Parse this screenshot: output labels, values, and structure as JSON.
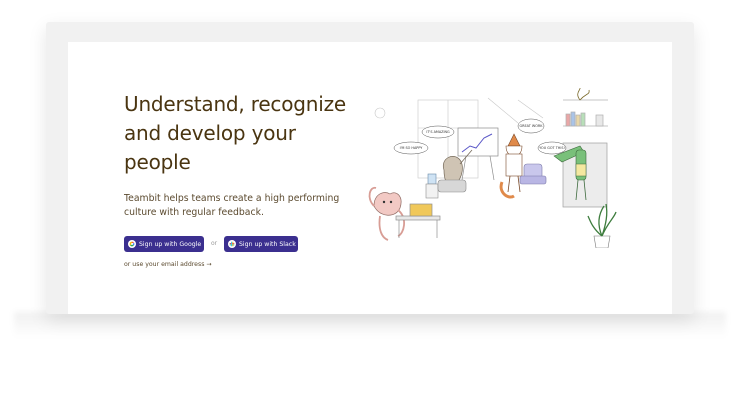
{
  "hero": {
    "headline": "Understand, recognize and develop your people",
    "subtext": "Teambit helps teams create a high performing culture with regular feedback."
  },
  "cta": {
    "google_label": "Sign up with Google",
    "or_label": "or",
    "slack_label": "Sign up with Slack",
    "email_link": "or use your email address →"
  },
  "illustration": {
    "bubbles": [
      "I'M SO HAPPY",
      "IT'S AMAZING",
      "GREAT WORK",
      "YOU GOT THIS!"
    ]
  },
  "colors": {
    "headline": "#4a3511",
    "button": "#3b2f8f",
    "frame": "#f1f1f1"
  },
  "icons": [
    "google-icon",
    "slack-icon",
    "arrow-right-icon"
  ]
}
